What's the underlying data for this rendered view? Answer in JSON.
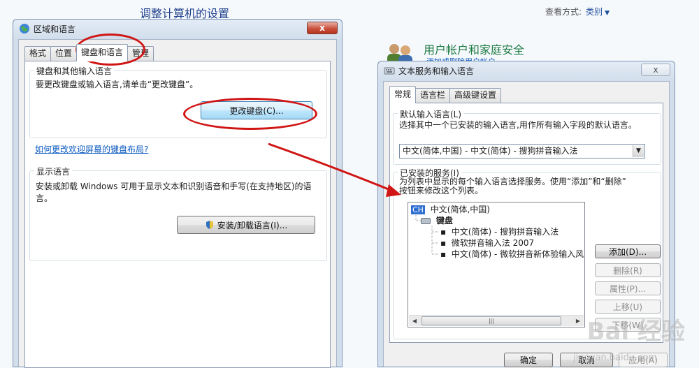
{
  "background": {
    "title": "调整计算机的设置",
    "view_label": "查看方式:",
    "view_value": "类别",
    "user_section_title": "用户帐户和家庭安全",
    "user_section_sub": "添加或删除用户帐户"
  },
  "region_window": {
    "title": "区域和语言",
    "close_glyph": "x",
    "tabs": [
      "格式",
      "位置",
      "键盘和语言",
      "管理"
    ],
    "keyboard_group": {
      "legend": "键盘和其他输入语言",
      "text": "要更改键盘或输入语言,请单击“更改键盘”。",
      "button": "更改键盘(C)...",
      "link": "如何更改欢迎屏幕的键盘布局?"
    },
    "display_group": {
      "legend": "显示语言",
      "text_line1": "安装或卸载 Windows 可用于显示文本和识别语音和手写(在支持地区)的语",
      "text_line2": "言。",
      "button": "安装/卸载语言(I)..."
    }
  },
  "text_services_window": {
    "title": "文本服务和输入语言",
    "close_glyph": "x",
    "tabs": [
      "常规",
      "语言栏",
      "高级键设置"
    ],
    "default_group": {
      "legend": "默认输入语言(L)",
      "text": "选择其中一个已安装的输入语言,用作所有输入字段的默认语言。",
      "combo_value": "中文(简体,中国) - 中文(简体) - 搜狗拼音输入法"
    },
    "installed_group": {
      "legend": "已安装的服务(I)",
      "text_line1": "为列表中显示的每个输入语言选择服务。使用“添加”和“删除”",
      "text_line2": "按钮来修改这个列表。",
      "tree": {
        "language_badge": "CH",
        "language": "中文(简体,中国)",
        "category": "键盘",
        "items": [
          "中文(简体) - 搜狗拼音输入法",
          "微软拼音输入法 2007",
          "中文(简体) - 微软拼音新体验输入风"
        ]
      },
      "buttons": {
        "add": "添加(D)...",
        "remove": "删除(R)",
        "properties": "属性(P)...",
        "move_up": "上移(U)",
        "move_down": "下移(W)"
      }
    },
    "footer": {
      "ok": "确定",
      "cancel": "取消",
      "apply": "应用(A)"
    }
  },
  "watermark": {
    "brand": "Bai 经验",
    "url": "jingyan.baidu.com"
  },
  "colors": {
    "annotation_red": "#d01515",
    "link_blue": "#0c5ac0",
    "heading_green": "#1d7a43"
  }
}
